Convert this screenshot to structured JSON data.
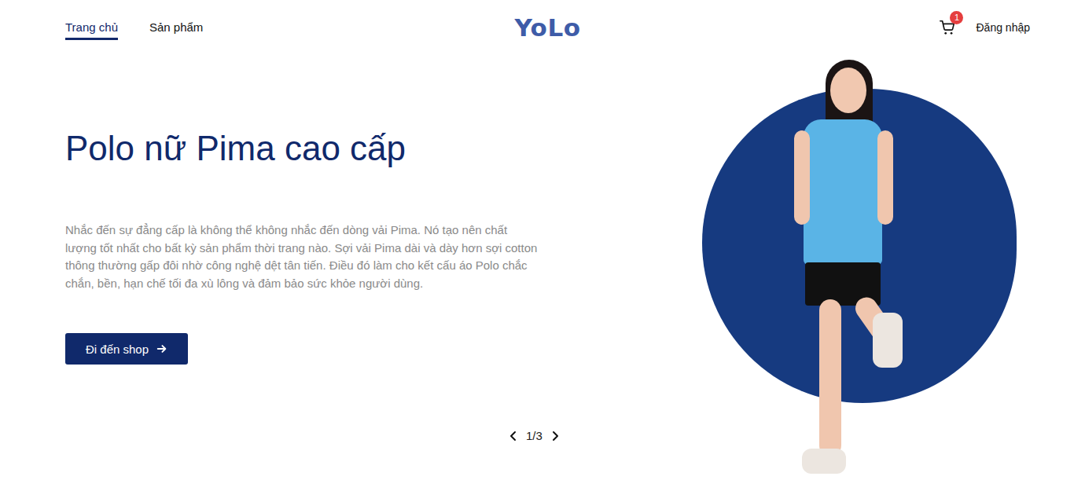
{
  "nav": {
    "items": [
      {
        "label": "Trang chủ",
        "selected": true
      },
      {
        "label": "Sản phẩm",
        "selected": false
      }
    ]
  },
  "logo": "YoLo",
  "cart": {
    "badge": "1"
  },
  "login": "Đăng nhập",
  "hero": {
    "title": "Polo nữ Pima cao cấp",
    "description": "Nhắc đến sự đẳng cấp là không thể không nhắc đến dòng vải Pima. Nó tạo nên chất lượng tốt nhất cho bất kỳ sản phẩm thời trang nào. Sợi vải Pima dài và dày hơn sợi cotton thông thường gấp đôi nhờ công nghệ dệt tân tiến. Điều đó làm cho kết cấu áo Polo chắc chắn, bền, hạn chế tối đa xù lông và đảm bảo sức khỏe người dùng.",
    "button": "Đi đến shop"
  },
  "pager": {
    "text": "1/3"
  }
}
